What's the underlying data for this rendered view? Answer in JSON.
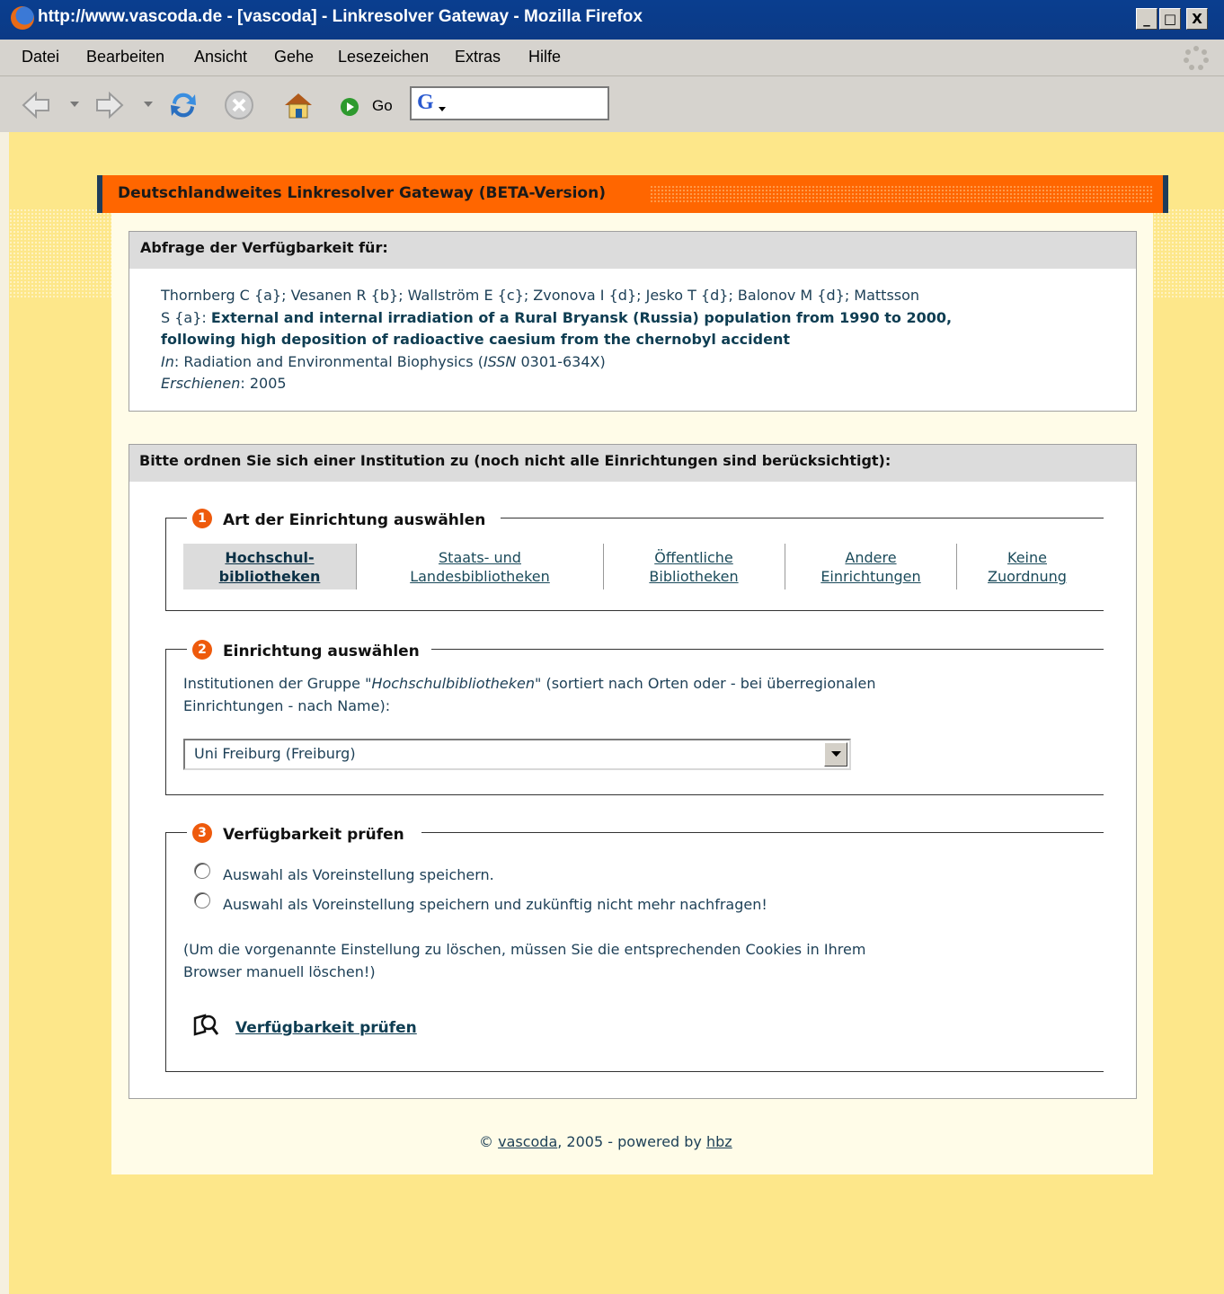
{
  "window": {
    "title": "http://www.vascoda.de - [vascoda] - Linkresolver Gateway - Mozilla Firefox",
    "min_label": "_",
    "max_label": "□",
    "close_label": "X"
  },
  "menu": [
    {
      "label": "Datei"
    },
    {
      "label": "Bearbeiten"
    },
    {
      "label": "Ansicht"
    },
    {
      "label": "Gehe"
    },
    {
      "label": "Lesezeichen"
    },
    {
      "label": "Extras"
    },
    {
      "label": "Hilfe"
    }
  ],
  "toolbar": {
    "go_label": "Go",
    "search_engine_icon": "G",
    "icons": [
      "back-icon",
      "forward-icon",
      "reload-icon",
      "stop-icon",
      "home-icon",
      "go-icon"
    ]
  },
  "page": {
    "header_title": "Deutschlandweites Linkresolver Gateway  (BETA-Version)",
    "query": {
      "heading": "Abfrage der Verfügbarkeit für:",
      "authors_line1": "Thornberg C {a}; Vesanen R {b}; Wallström E {c}; Zvonova I {d}; Jesko T {d}; Balonov M {d}; Mattsson",
      "authors_line2_prefix": "S {a}: ",
      "title_part1": "External and internal irradiation of a Rural Bryansk (Russia) population from 1990 to 2000,",
      "title_part2": "following high deposition of radioactive caesium from the chernobyl accident",
      "in_label": "In",
      "journal_prefix": ": Radiation and Environmental Biophysics (",
      "issn_label": "ISSN",
      "journal_suffix": " 0301-634X)",
      "published_label": "Erschienen",
      "published_value": ": 2005"
    },
    "institution": {
      "heading": "Bitte ordnen Sie sich einer Institution zu (noch nicht alle Einrichtungen sind berücksichtigt):",
      "step1": {
        "number": "1",
        "legend": "Art der Einrichtung auswählen",
        "tabs": [
          {
            "line1": "Hochschul-",
            "line2": "bibliotheken"
          },
          {
            "line1": "Staats- und",
            "line2": "Landesbibliotheken"
          },
          {
            "line1": "Öffentliche",
            "line2": "Bibliotheken"
          },
          {
            "line1": "Andere",
            "line2": "Einrichtungen"
          },
          {
            "line1": "Keine",
            "line2": "Zuordnung"
          }
        ]
      },
      "step2": {
        "number": "2",
        "legend": "Einrichtung auswählen",
        "desc_prefix": "Institutionen der Gruppe \"",
        "desc_group": "Hochschulbibliotheken",
        "desc_suffix1": "\" (sortiert nach Orten oder - bei überregionalen",
        "desc_line2": "Einrichtungen - nach Name):",
        "selected": "Uni Freiburg (Freiburg)"
      },
      "step3": {
        "number": "3",
        "legend": "Verfügbarkeit prüfen",
        "option1": "Auswahl als Voreinstellung speichern.",
        "option2": "Auswahl als Voreinstellung speichern und zukünftig nicht mehr nachfragen!",
        "note_line1": "(Um die vorgenannte Einstellung zu löschen, müssen Sie die entsprechenden Cookies in Ihrem",
        "note_line2": "Browser manuell löschen!)",
        "check_link": "Verfügbarkeit prüfen"
      }
    },
    "footer": {
      "copyright": "©",
      "vascoda": "vascoda",
      "middle": ", 2005 - powered by ",
      "hbz": "hbz"
    }
  },
  "colors": {
    "titlebar": "#0b3a86",
    "page_bg": "#fde78a",
    "header_orange": "#ff6600",
    "step_number": "#ee5a0c",
    "text": "#1c3f56"
  }
}
